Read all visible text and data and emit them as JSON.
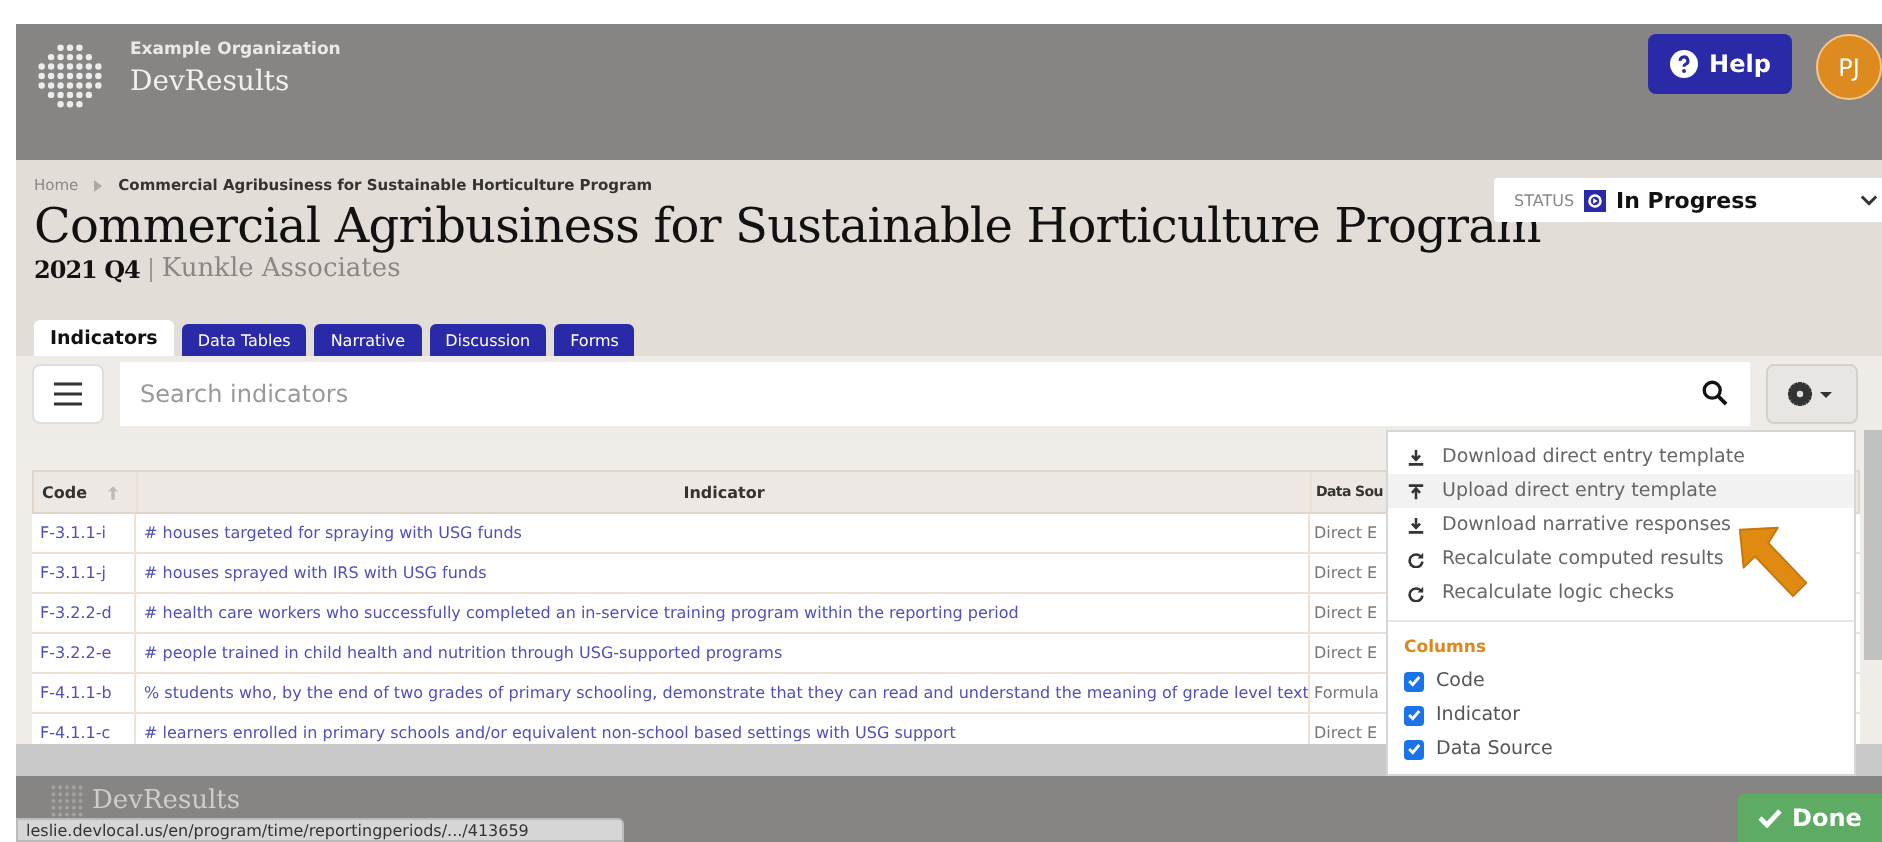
{
  "header": {
    "organization": "Example Organization",
    "app_name": "DevResults",
    "help_button": "Help",
    "avatar": "PJ"
  },
  "breadcrumb": [
    "Home",
    "Commercial Agribusiness for Sustainable Horticulture Program"
  ],
  "page_title": "Commercial Agribusiness for Sustainable Horticulture Program",
  "period": "2021 Q4",
  "organization": "Kunkle Associates",
  "status": {
    "label": "STATUS",
    "value": "In Progress"
  },
  "tabs": [
    {
      "label": "Indicators",
      "selected": true
    },
    {
      "label": "Data Tables",
      "selected": false
    },
    {
      "label": "Narrative",
      "selected": false
    },
    {
      "label": "Discussion",
      "selected": false
    },
    {
      "label": "Forms",
      "selected": false
    }
  ],
  "search": {
    "placeholder": "Search indicators"
  },
  "table": {
    "columns": [
      "Code",
      "Indicator",
      "Data Sou"
    ],
    "rows": [
      {
        "code": "F-3.1.1-i",
        "indicator": "# houses targeted for spraying with USG funds",
        "data_source": "Direct E"
      },
      {
        "code": "F-3.1.1-j",
        "indicator": "# houses sprayed with IRS with USG funds",
        "data_source": "Direct E"
      },
      {
        "code": "F-3.2.2-d",
        "indicator": "# health care workers who successfully completed an in-service training program within the reporting period",
        "data_source": "Direct E"
      },
      {
        "code": "F-3.2.2-e",
        "indicator": "# people trained in child health and nutrition through USG-supported programs",
        "data_source": "Direct E"
      },
      {
        "code": "F-4.1.1-b",
        "indicator": "% students who, by the end of two grades of primary schooling, demonstrate that they can read and understand the meaning of grade level text",
        "data_source": "Formula"
      },
      {
        "code": "F-4.1.1-c",
        "indicator": "# learners enrolled in primary schools and/or equivalent non-school based settings with USG support",
        "data_source": "Direct E"
      }
    ]
  },
  "settings_menu": {
    "actions": [
      {
        "label": "Download direct entry template",
        "kind": "download",
        "selected": false
      },
      {
        "label": "Upload direct entry template",
        "kind": "upload",
        "selected": true
      },
      {
        "label": "Download narrative responses",
        "kind": "download",
        "selected": false
      },
      {
        "label": "Recalculate computed results",
        "kind": "refresh",
        "selected": false
      },
      {
        "label": "Recalculate logic checks",
        "kind": "refresh",
        "selected": false
      }
    ],
    "columns_heading": "Columns",
    "columns": [
      {
        "label": "Code",
        "checked": true
      },
      {
        "label": "Indicator",
        "checked": true
      },
      {
        "label": "Data Source",
        "checked": true
      }
    ]
  },
  "footer": {
    "logo_text": "DevResults",
    "done_button": "Done"
  },
  "status_url": "leslie.devlocal.us/en/program/time/reportingperiods/.../413659"
}
